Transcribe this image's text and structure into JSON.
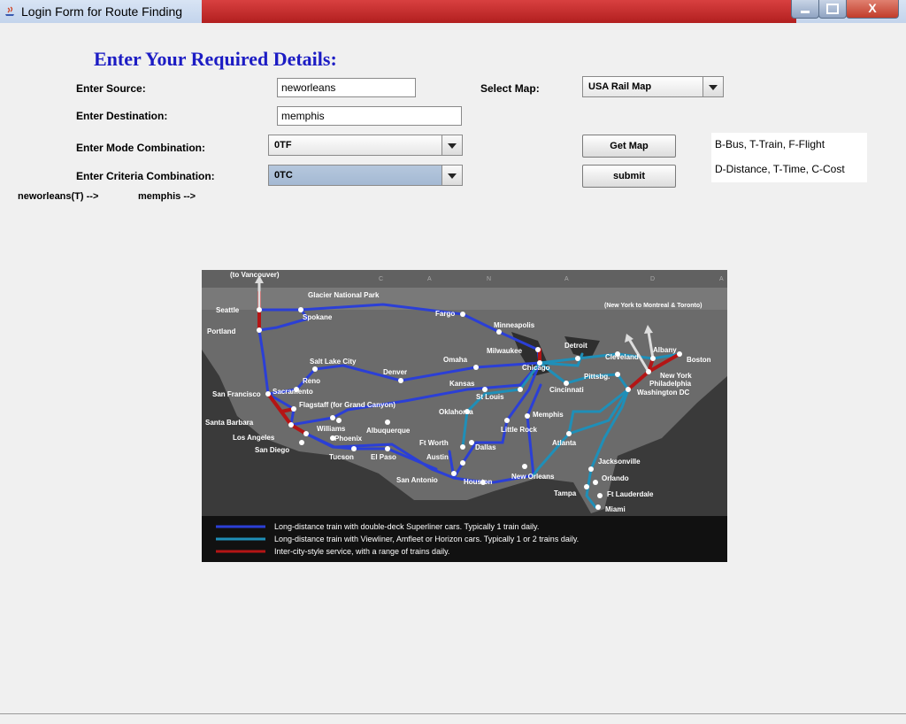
{
  "window": {
    "title": "Login Form for Route Finding",
    "controls": {
      "min": "minimize",
      "max": "maximize",
      "close": "X"
    }
  },
  "form": {
    "heading": "Enter Your Required Details:",
    "source_label": "Enter Source:",
    "source_value": "neworleans",
    "destination_label": "Enter Destination:",
    "destination_value": "memphis",
    "mode_label": "Enter Mode Combination:",
    "mode_value": "0TF",
    "criteria_label": "Enter Criteria Combination:",
    "criteria_value": "0TC",
    "select_map_label": "Select Map:",
    "select_map_value": "USA Rail Map",
    "get_map_button": "Get Map",
    "submit_button": "submit"
  },
  "legend": {
    "modes": "B-Bus, T-Train, F-Flight",
    "criteria": "D-Distance, T-Time, C-Cost"
  },
  "route": {
    "step1": "neworleans(T) -->",
    "step2": "memphis -->"
  },
  "map": {
    "grid_letters": [
      "C",
      "A",
      "N",
      "A",
      "D",
      "A"
    ],
    "cities": {
      "vancouver": "(to Vancouver)",
      "glacier": "Glacier National Park",
      "seattle": "Seattle",
      "spokane": "Spokane",
      "portland": "Portland",
      "fargo": "Fargo",
      "minneapolis": "Minneapolis",
      "nytomontreal": "(New York to Montreal & Toronto)",
      "detroit": "Detroit",
      "albany": "Albany",
      "boston": "Boston",
      "milwaukee": "Milwaukee",
      "cleveland": "Cleveland",
      "chicago": "Chicago",
      "newyork": "New York",
      "saltlake": "Salt Lake City",
      "omaha": "Omaha",
      "pittsbg": "Pittsbg.",
      "philadelphia": "Philadelphia",
      "reno": "Reno",
      "denver": "Denver",
      "washington": "Washington DC",
      "kansas": "Kansas",
      "cincinnati": "Cincinnati",
      "sanfrancisco": "San Francisco",
      "sacramento": "Sacramento",
      "stlouis": "St Louis",
      "flagstaff": "Flagstaff (for Grand Canyon)",
      "oklahoma": "Oklahoma",
      "memphis": "Memphis",
      "santabarbara": "Santa Barbara",
      "williams": "Williams",
      "albuquerque": "Albuquerque",
      "littlerock": "Little Rock",
      "losangeles": "Los Angeles",
      "phoenix": "Phoenix",
      "ftworth": "Ft Worth",
      "dallas": "Dallas",
      "atlanta": "Atlanta",
      "sandiego": "San Diego",
      "tucson": "Tucson",
      "elpaso": "El Paso",
      "austin": "Austin",
      "jacksonville": "Jacksonville",
      "sanantonio": "San Antonio",
      "houston": "Houston",
      "neworleans": "New Orleans",
      "orlando": "Orlando",
      "tampa": "Tampa",
      "ftlauderdale": "Ft Lauderdale",
      "miami": "Miami"
    },
    "legend": [
      {
        "color": "#2b3fd6",
        "text": "Long-distance train with double-deck Superliner cars.  Typically 1 train daily."
      },
      {
        "color": "#1f8fb8",
        "text": "Long-distance train with Viewliner, Amfleet or Horizon cars.  Typically 1 or 2 trains daily."
      },
      {
        "color": "#b41515",
        "text": "Inter-city-style service, with a range of trains daily."
      }
    ]
  }
}
